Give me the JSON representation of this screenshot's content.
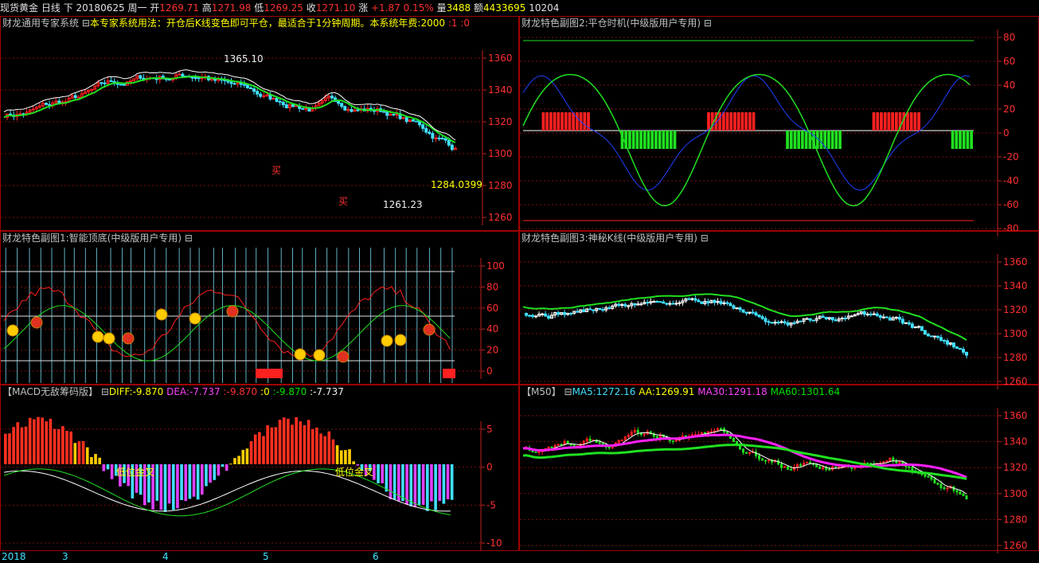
{
  "topbar": {
    "symbol": "现货黄金",
    "period": "日线",
    "arrow": "下",
    "date": "20180625",
    "weekday": "周一",
    "open_label": "开",
    "open": "1269.71",
    "high_label": "高",
    "high": "1271.98",
    "low_label": "低",
    "low": "1269.25",
    "close_label": "收",
    "close": "1271.10",
    "change_label": "涨",
    "change": "+1.87",
    "change_pct": "0.15%",
    "volume_label": "量",
    "volume": "3488",
    "amount_label": "额",
    "amount": "4433695",
    "extra": "10204"
  },
  "panels": {
    "main": {
      "title": "财龙通用专家系统",
      "icon_name": "toggle-icon",
      "note": "本专家系统用法：开仓后K线变色即可平仓，最适合于1分钟周期。本系统年费:2000",
      "flags": ":1 :0",
      "annotations": {
        "high": "1365.10",
        "low": "1261.23",
        "last": "1284.0399",
        "buy1": "买",
        "buy2": "买"
      },
      "y_ticks": [
        "1360",
        "1340",
        "1320",
        "1300",
        "1280",
        "1260"
      ]
    },
    "sub2": {
      "title": "财龙特色副图2:平仓时机(中级版用户专用)",
      "y_ticks": [
        "80",
        "60",
        "40",
        "20",
        "0",
        "-20",
        "-40",
        "-60",
        "-80"
      ]
    },
    "sub1": {
      "title": "财龙特色副图1:智能顶底(中级版用户专用)",
      "y_ticks": [
        "100",
        "80",
        "60",
        "40",
        "20",
        "0"
      ]
    },
    "sub3": {
      "title": "财龙特色副图3:神秘K线(中级版用户专用)",
      "y_ticks": [
        "1360",
        "1340",
        "1320",
        "1300",
        "1280",
        "1260"
      ]
    },
    "macd": {
      "title": "【MACD无敌筹码版】",
      "diff": "DIFF:-9.870",
      "dea": "DEA:-7.737",
      "v1": ":-9.870",
      "v2": ":0",
      "v3": ":-9.870",
      "v4": ":-7.737",
      "label1": "低位金叉",
      "label2": "低位金叉",
      "y_ticks": [
        "5",
        "0",
        "-5",
        "-10"
      ]
    },
    "m50": {
      "title": "【M50】",
      "ma5": "MA5:1272.16",
      "aa": "AA:1269.91",
      "ma30": "MA30:1291.18",
      "ma60": "MA60:1301.64",
      "y_ticks": [
        "1360",
        "1340",
        "1320",
        "1300",
        "1280",
        "1260"
      ]
    }
  },
  "bottom_axis": {
    "year": "2018",
    "months": [
      "3",
      "4",
      "5",
      "6"
    ]
  },
  "colors": {
    "up": "#ff2020",
    "down": "#40e0ff",
    "ma_green": "#20e020",
    "ma_magenta": "#ff20ff",
    "border": "#a00000",
    "grid": "#8a1010"
  }
}
